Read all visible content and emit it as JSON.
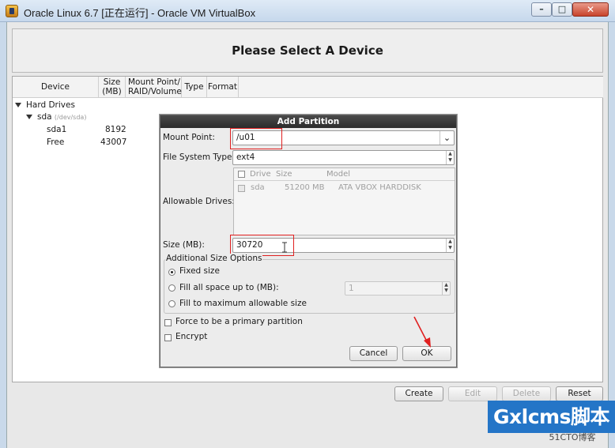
{
  "window": {
    "title": "Oracle Linux 6.7 [正在运行] - Oracle VM VirtualBox",
    "minimize": "–",
    "maximize": "□",
    "close": "✕"
  },
  "header": {
    "title": "Please Select A Device"
  },
  "columns": {
    "device": "Device",
    "size_line1": "Size",
    "size_line2": "(MB)",
    "mount_line1": "Mount Point/",
    "mount_line2": "RAID/Volume",
    "type": "Type",
    "format": "Format"
  },
  "tree": {
    "hard_drives": "Hard Drives",
    "disk": "sda",
    "disk_path": "(/dev/sda)",
    "rows": [
      {
        "name": "sda1",
        "size": "8192"
      },
      {
        "name": "Free",
        "size": "43007"
      }
    ]
  },
  "dialog": {
    "title": "Add Partition",
    "mount_point_label": "Mount Point:",
    "mount_point_value": "/u01",
    "fs_type_label": "File System Type:",
    "fs_type_value": "ext4",
    "allowable_drives_label": "Allowable Drives:",
    "drives_header": {
      "drive": "Drive",
      "size": "Size",
      "model": "Model"
    },
    "drives": [
      {
        "drive": "sda",
        "size": "51200 MB",
        "model": "ATA VBOX HARDDISK"
      }
    ],
    "size_label": "Size (MB):",
    "size_value": "30720",
    "options_title": "Additional Size Options",
    "opt_fixed": "Fixed size",
    "opt_fill_upto": "Fill all space up to (MB):",
    "fill_upto_value": "1",
    "opt_fill_max": "Fill to maximum allowable size",
    "primary_label": "Force to be a primary partition",
    "encrypt_label": "Encrypt",
    "cancel": "Cancel",
    "ok": "OK"
  },
  "actions": {
    "create": "Create",
    "edit": "Edit",
    "delete": "Delete",
    "reset": "Reset"
  },
  "watermark": {
    "brand": "Gxlcms脚本",
    "sub": "51CTO博客"
  },
  "colors": {
    "highlight": "#e02020",
    "watermark_bg": "#2475c7"
  }
}
